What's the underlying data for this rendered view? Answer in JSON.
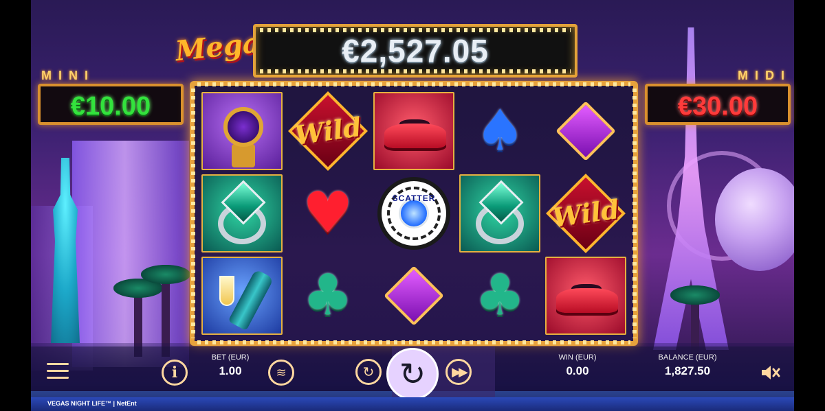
{
  "game": {
    "title": "VEGAS NIGHT LIFE™",
    "separator": "|",
    "provider": "NetEnt"
  },
  "jackpots": {
    "mega": {
      "label": "Mega",
      "value": "€2,527.05"
    },
    "mini": {
      "label": "MINI",
      "value": "€10.00"
    },
    "midi": {
      "label": "MIDI",
      "value": "€30.00"
    }
  },
  "reels": {
    "rows": [
      [
        "watch",
        "wild",
        "car",
        "spade",
        "diamond"
      ],
      [
        "ring",
        "heart",
        "scatter",
        "ring",
        "wild"
      ],
      [
        "champagne",
        "club",
        "diamond",
        "club",
        "car"
      ]
    ],
    "wild_text": "Wild",
    "scatter_text": "SCATTER"
  },
  "hud": {
    "bet_label": "BET (EUR)",
    "bet_value": "1.00",
    "win_label": "WIN (EUR)",
    "win_value": "0.00",
    "balance_label": "BALANCE (EUR)",
    "balance_value": "1,827.50",
    "info_symbol": "i"
  },
  "colors": {
    "frame": "#e7a23c",
    "mini_value": "#33e23d",
    "midi_value": "#ff3b3b"
  }
}
